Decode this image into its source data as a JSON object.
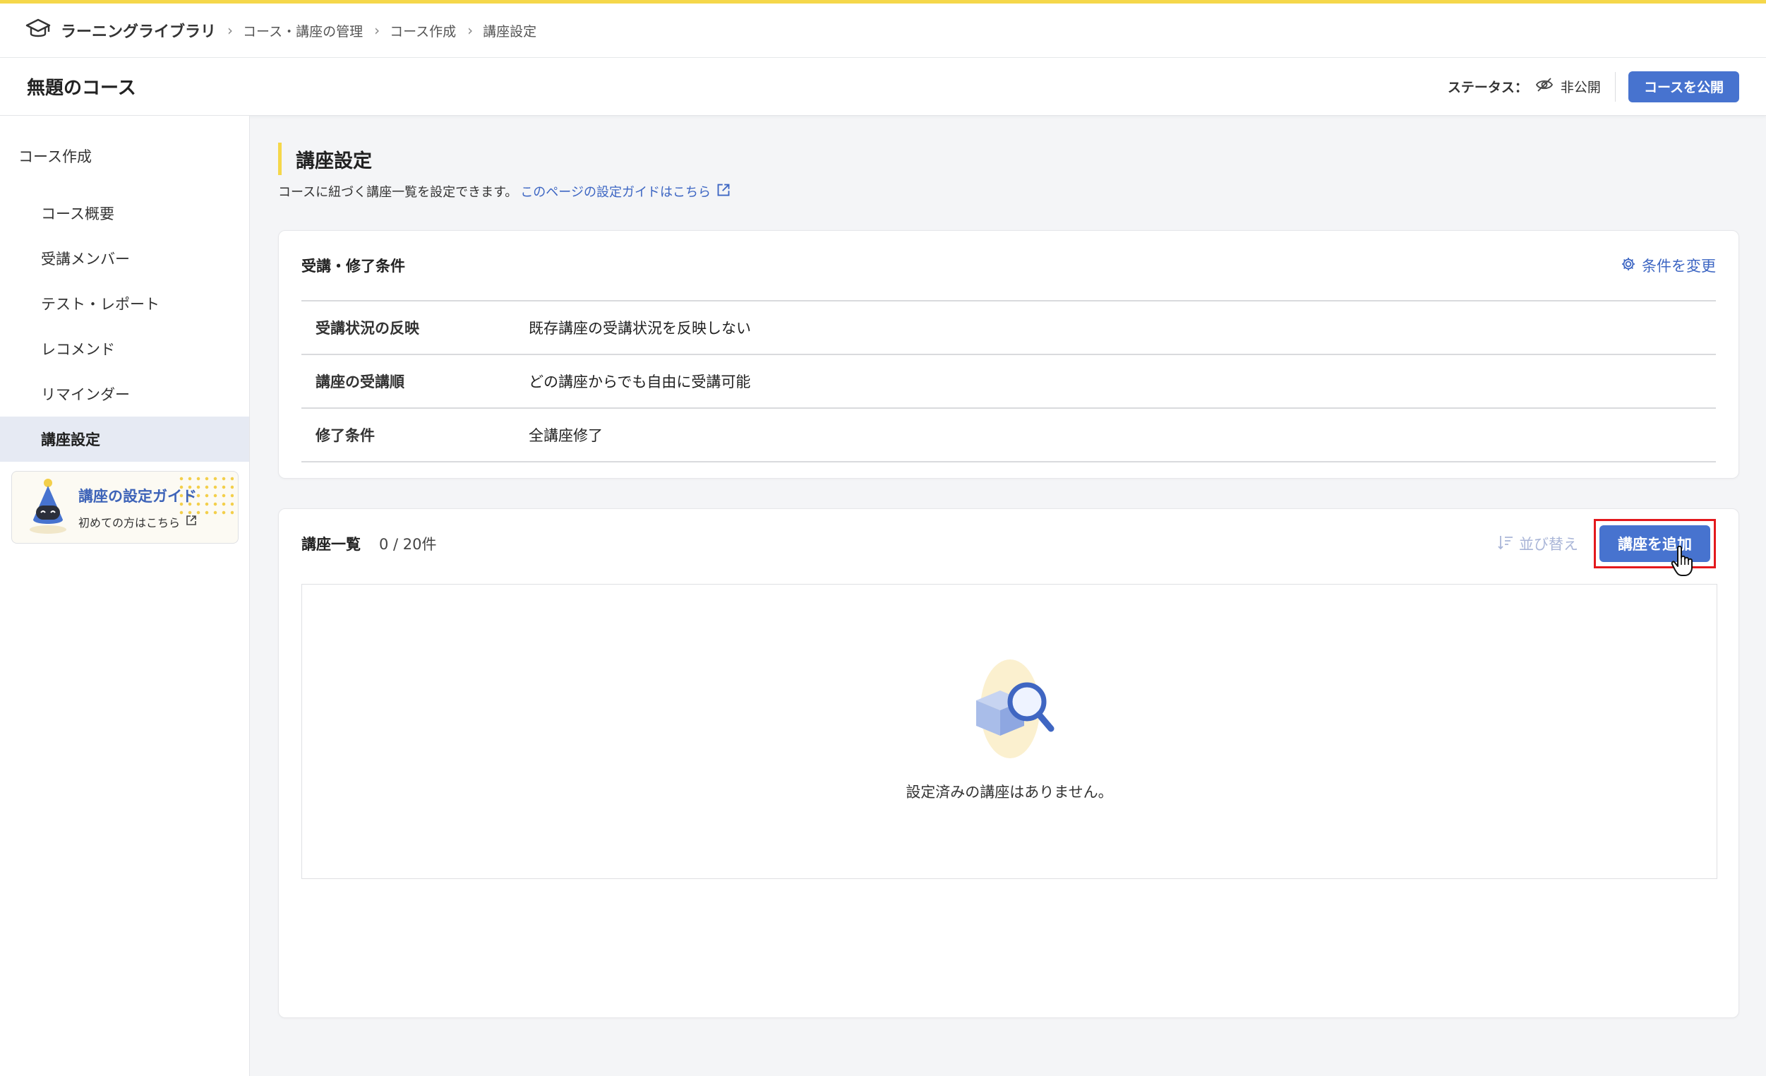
{
  "topbar": {
    "brand": "ラーニングライブラリ",
    "breadcrumb": [
      "コース・講座の管理",
      "コース作成",
      "講座設定"
    ]
  },
  "header": {
    "title": "無題のコース",
    "status_label": "ステータス：",
    "status_value": "非公開",
    "publish_button": "コースを公開"
  },
  "sidebar": {
    "section": "コース作成",
    "items": [
      {
        "label": "コース概要"
      },
      {
        "label": "受講メンバー"
      },
      {
        "label": "テスト・レポート"
      },
      {
        "label": "レコメンド"
      },
      {
        "label": "リマインダー"
      },
      {
        "label": "講座設定",
        "active": true
      }
    ],
    "guide_title": "講座の設定ガイド",
    "guide_sub": "初めての方はこちら"
  },
  "main": {
    "section_title": "講座設定",
    "description": "コースに紐づく講座一覧を設定できます。",
    "guide_link": "このページの設定ガイドはこちら",
    "conditions": {
      "title": "受講・修了条件",
      "action": "条件を変更",
      "rows": [
        {
          "label": "受講状況の反映",
          "value": "既存講座の受講状況を反映しない"
        },
        {
          "label": "講座の受講順",
          "value": "どの講座からでも自由に受講可能"
        },
        {
          "label": "修了条件",
          "value": "全講座修了"
        }
      ]
    },
    "lectures": {
      "title": "講座一覧",
      "count": "0 / 20件",
      "sort_label": "並び替え",
      "add_button": "講座を追加",
      "empty_text": "設定済みの講座はありません。"
    }
  },
  "colors": {
    "accent": "#4773cf",
    "highlight": "#f5d74a",
    "link": "#3d66c3",
    "emphasis_box": "#e3191d"
  }
}
